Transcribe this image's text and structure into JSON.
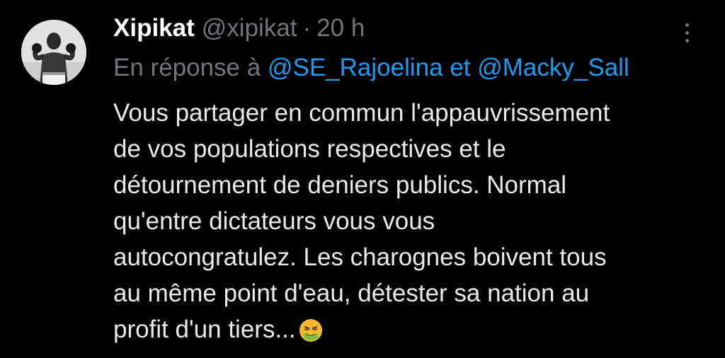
{
  "tweet": {
    "author": {
      "display_name": "Xipikat",
      "handle": "@xipikat",
      "avatar_icon": "boxer-photo-avatar"
    },
    "separator": "·",
    "time": "20 h",
    "more_icon": "vertical-ellipsis-icon",
    "reply": {
      "prefix": "En réponse à",
      "mention_1": "@SE_Rajoelina",
      "conjunction": "et",
      "mention_2": "@Macky_Sall"
    },
    "text_lines": [
      "Vous partager en commun l'appauvrissement",
      "de vos populations respectives et le",
      "détournement de deniers publics. Normal",
      "qu'entre dictateurs vous vous",
      "autocongratulez. Les charognes boivent tous",
      "au même point d'eau, détester sa nation au",
      "profit d'un tiers..."
    ],
    "trailing_emoji": "nauseated-face-icon"
  },
  "colors": {
    "background": "#000000",
    "primary_text": "#e7e9ea",
    "secondary_text": "#71767b",
    "link": "#1d9bf0",
    "emoji": "#f5b82e"
  }
}
